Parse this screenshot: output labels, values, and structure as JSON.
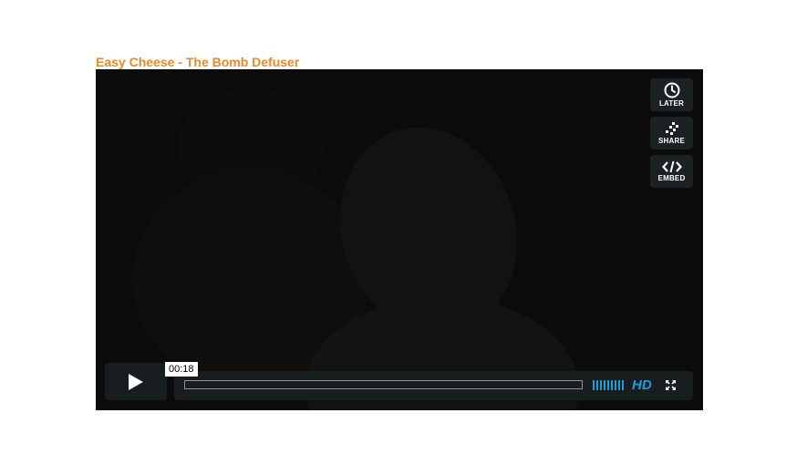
{
  "video": {
    "title": "Easy Cheese - The Bomb Defuser"
  },
  "side_buttons": [
    {
      "label": "LATER",
      "icon": "clock-icon"
    },
    {
      "label": "SHARE",
      "icon": "share-icon"
    },
    {
      "label": "EMBED",
      "icon": "code-icon"
    }
  ],
  "controls": {
    "current_time": "00:18",
    "progress_fraction": 0,
    "volume_bars": 9,
    "hd_label": "HD",
    "play_icon": "play-icon",
    "fullscreen_icon": "fullscreen-icon"
  },
  "colors": {
    "title": "#e8892d",
    "accent": "#1a9fd9",
    "player_bg": "#0b0b0b",
    "button_bg": "#202628"
  }
}
